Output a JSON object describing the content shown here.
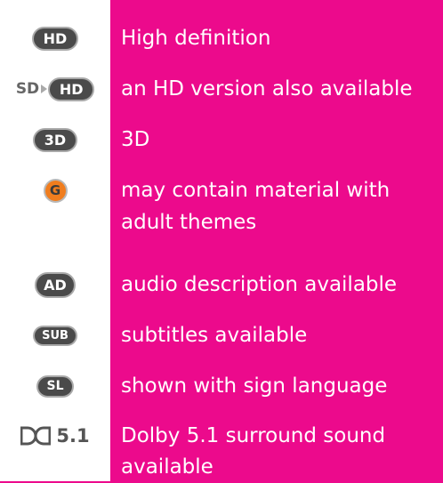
{
  "legend": {
    "rows": [
      {
        "icon": "hd-badge-icon",
        "icon_text": "HD",
        "description": "High definition"
      },
      {
        "icon": "sd-hd-badge-icon",
        "icon_text_sd": "SD",
        "icon_text": "HD",
        "description": "an HD version also available"
      },
      {
        "icon": "3d-badge-icon",
        "icon_text": "3D",
        "description": "3D"
      },
      {
        "icon": "g-rating-icon",
        "icon_text": "G",
        "description_line1": "may contain material with",
        "description_line2": "adult themes"
      },
      {
        "icon": "ad-badge-icon",
        "icon_text": "AD",
        "description": "audio description available"
      },
      {
        "icon": "sub-badge-icon",
        "icon_text": "SUB",
        "description": "subtitles available"
      },
      {
        "icon": "sl-badge-icon",
        "icon_text": "SL",
        "description": "shown with sign language"
      },
      {
        "icon": "dolby-icon",
        "icon_text": "5.1",
        "description_line1": "Dolby 5.1 surround sound",
        "description_line2": "available"
      }
    ]
  },
  "colors": {
    "background": "#ec0a8c",
    "icon_column": "#ffffff",
    "badge": "#4a4a4a",
    "badge_border": "#a9a9a9",
    "g_rating": "#f07d1e"
  }
}
